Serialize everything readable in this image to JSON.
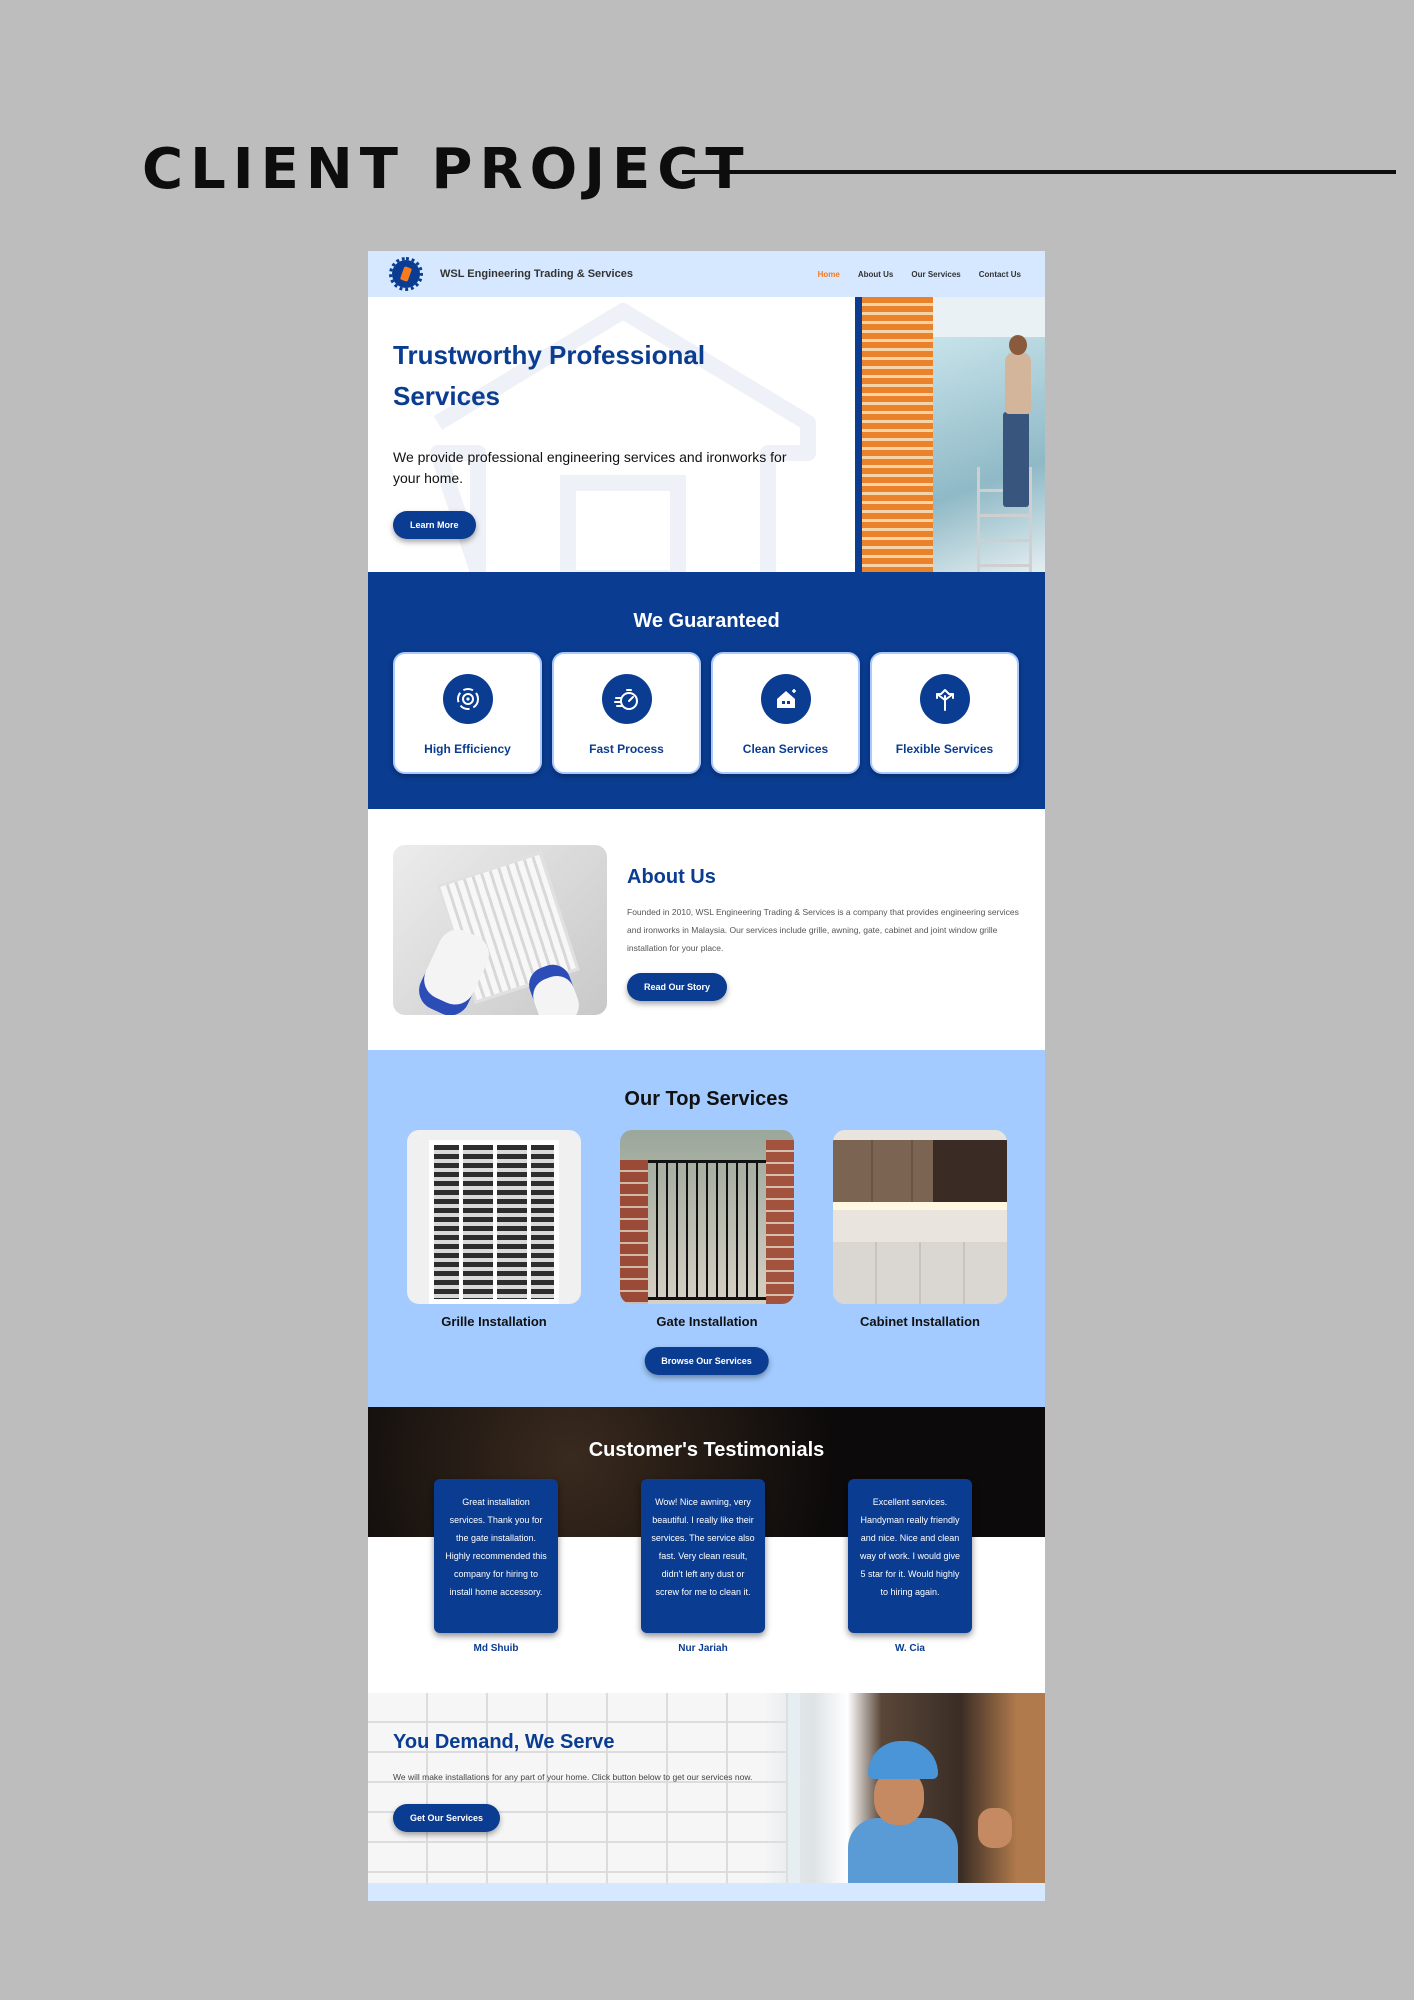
{
  "page": {
    "heading": "CLIENT PROJECT"
  },
  "nav": {
    "brand": "WSL Engineering Trading & Services",
    "links": [
      "Home",
      "About Us",
      "Our Services",
      "Contact Us"
    ],
    "active_link": "Home",
    "active_color": "#f47b20"
  },
  "hero": {
    "title": "Trustworthy Professional Services",
    "description": "We provide professional engineering services and ironworks for your home.",
    "button": "Learn More"
  },
  "guarantee": {
    "title": "We Guaranteed",
    "cards": [
      {
        "label": "High Efficiency",
        "icon": "gear-cycle-icon"
      },
      {
        "label": "Fast Process",
        "icon": "stopwatch-icon"
      },
      {
        "label": "Clean Services",
        "icon": "house-sparkle-icon"
      },
      {
        "label": "Flexible Services",
        "icon": "arrows-split-icon"
      }
    ]
  },
  "about": {
    "title": "About Us",
    "description": "Founded in 2010, WSL Engineering Trading & Services is a company that provides engineering services and ironworks in Malaysia. Our services include grille, awning, gate, cabinet and joint window grille installation for your place.",
    "button": "Read Our Story"
  },
  "services": {
    "title": "Our Top Services",
    "items": [
      {
        "label": "Grille Installation"
      },
      {
        "label": "Gate Installation"
      },
      {
        "label": "Cabinet Installation"
      }
    ],
    "button": "Browse Our Services"
  },
  "testimonials": {
    "title": "Customer's Testimonials",
    "items": [
      {
        "text": "Great installation services. Thank you for the gate installation. Highly recommended this company for hiring to install home accessory.",
        "name": "Md Shuib"
      },
      {
        "text": "Wow! Nice awning, very beautiful. I really like their services. The service also fast. Very clean result, didn't left any dust or screw for me to clean it.",
        "name": "Nur Jariah"
      },
      {
        "text": "Excellent services. Handyman really friendly and nice. Nice and clean way of work. I would give 5 star for it. Would highly to hiring again.",
        "name": "W. Cia"
      }
    ]
  },
  "cta": {
    "title": "You Demand, We Serve",
    "description": "We will make installations for any part of your home. Click button below to get our services now.",
    "button": "Get Our Services"
  },
  "colors": {
    "primary": "#0a3c91",
    "nav_bg": "#d6e8ff",
    "services_bg": "#a3cbff",
    "accent": "#f47b20"
  }
}
